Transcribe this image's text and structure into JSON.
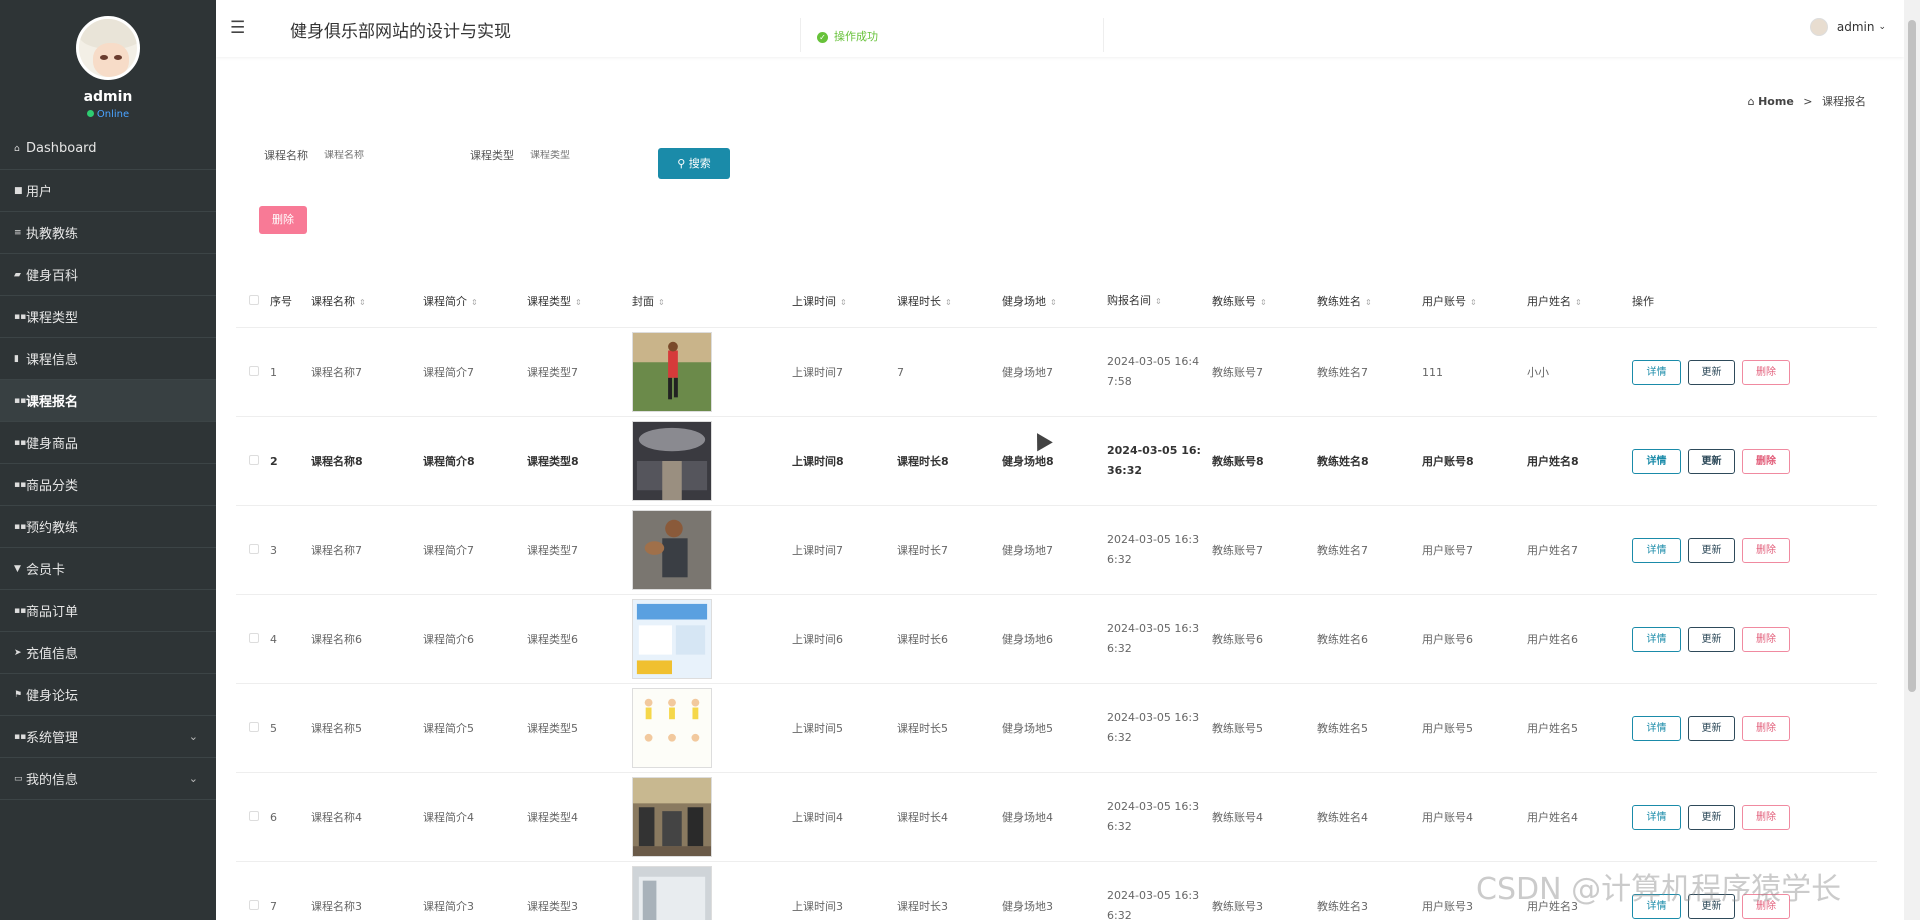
{
  "sidebar": {
    "profile": {
      "name": "admin",
      "status": "Online"
    },
    "items": [
      {
        "label": "Dashboard",
        "icon": "home-icon"
      },
      {
        "label": "用户",
        "icon": "user-icon"
      },
      {
        "label": "执教教练",
        "icon": "list-icon"
      },
      {
        "label": "健身百科",
        "icon": "book-icon"
      },
      {
        "label": "课程类型",
        "icon": "grid-icon"
      },
      {
        "label": "课程信息",
        "icon": "chart-icon"
      },
      {
        "label": "课程报名",
        "icon": "grid-icon"
      },
      {
        "label": "健身商品",
        "icon": "grid-icon"
      },
      {
        "label": "商品分类",
        "icon": "grid-icon"
      },
      {
        "label": "预约教练",
        "icon": "grid-icon"
      },
      {
        "label": "会员卡",
        "icon": "trophy-icon"
      },
      {
        "label": "商品订单",
        "icon": "grid-icon"
      },
      {
        "label": "充值信息",
        "icon": "send-icon"
      },
      {
        "label": "健身论坛",
        "icon": "flag-icon"
      },
      {
        "label": "系统管理",
        "icon": "grid-icon"
      },
      {
        "label": "我的信息",
        "icon": "card-icon"
      }
    ],
    "active_index": 6
  },
  "header": {
    "title": "健身俱乐部网站的设计与实现",
    "toast": "操作成功",
    "user": "admin"
  },
  "breadcrumb": {
    "home": "Home",
    "sep": ">",
    "current": "课程报名"
  },
  "search": {
    "course_name_label": "课程名称",
    "course_name_placeholder": "课程名称",
    "course_type_label": "课程类型",
    "course_type_placeholder": "课程类型",
    "search_button": "搜索",
    "delete_button": "删除"
  },
  "table": {
    "columns": [
      "序号",
      "课程名称",
      "课程简介",
      "课程类型",
      "封面",
      "上课时间",
      "课程时长",
      "健身场地",
      "购报名间",
      "教练账号",
      "教练姓名",
      "用户账号",
      "用户姓名",
      "操作"
    ],
    "rows": [
      {
        "idx": "1",
        "name": "课程名称7",
        "intro": "课程简介7",
        "type": "课程类型7",
        "time": "上课时间7",
        "dur": "7",
        "place": "健身场地7",
        "date": "2024-03-05 16:47:58",
        "cno": "教练账号7",
        "cname": "教练姓名7",
        "uno": "111",
        "uname": "小小",
        "bold": false,
        "cover": "runner"
      },
      {
        "idx": "2",
        "name": "课程名称8",
        "intro": "课程简介8",
        "type": "课程类型8",
        "time": "上课时间8",
        "dur": "课程时长8",
        "place": "健身场地8",
        "date": "2024-03-05 16:36:32",
        "cno": "教练账号8",
        "cname": "教练姓名8",
        "uno": "用户账号8",
        "uname": "用户姓名8",
        "bold": true,
        "cover": "gym-hall"
      },
      {
        "idx": "3",
        "name": "课程名称7",
        "intro": "课程简介7",
        "type": "课程类型7",
        "time": "上课时间7",
        "dur": "课程时长7",
        "place": "健身场地7",
        "date": "2024-03-05 16:36:32",
        "cno": "教练账号7",
        "cname": "教练姓名7",
        "uno": "用户账号7",
        "uname": "用户姓名7",
        "bold": false,
        "cover": "muscle"
      },
      {
        "idx": "4",
        "name": "课程名称6",
        "intro": "课程简介6",
        "type": "课程类型6",
        "time": "上课时间6",
        "dur": "课程时长6",
        "place": "健身场地6",
        "date": "2024-03-05 16:36:32",
        "cno": "教练账号6",
        "cname": "教练姓名6",
        "uno": "用户账号6",
        "uname": "用户姓名6",
        "bold": false,
        "cover": "poster"
      },
      {
        "idx": "5",
        "name": "课程名称5",
        "intro": "课程简介5",
        "type": "课程类型5",
        "time": "上课时间5",
        "dur": "课程时长5",
        "place": "健身场地5",
        "date": "2024-03-05 16:36:32",
        "cno": "教练账号5",
        "cname": "教练姓名5",
        "uno": "用户账号5",
        "uname": "用户姓名5",
        "bold": false,
        "cover": "cartoon"
      },
      {
        "idx": "6",
        "name": "课程名称4",
        "intro": "课程简介4",
        "type": "课程类型4",
        "time": "上课时间4",
        "dur": "课程时长4",
        "place": "健身场地4",
        "date": "2024-03-05 16:36:32",
        "cno": "教练账号4",
        "cname": "教练姓名4",
        "uno": "用户账号4",
        "uname": "用户姓名4",
        "bold": false,
        "cover": "machines"
      },
      {
        "idx": "7",
        "name": "课程名称3",
        "intro": "课程简介3",
        "type": "课程类型3",
        "time": "上课时间3",
        "dur": "课程时长3",
        "place": "健身场地3",
        "date": "2024-03-05 16:36:32",
        "cno": "教练账号3",
        "cname": "教练姓名3",
        "uno": "用户账号3",
        "uname": "用户姓名3",
        "bold": false,
        "cover": "room"
      }
    ],
    "ops": {
      "detail": "详情",
      "update": "更新",
      "delete": "删除"
    }
  },
  "watermark": "CSDN @计算机程序猿学长",
  "colors": {
    "sidebar_bg": "#2e3436",
    "primary": "#1a8ba9",
    "danger": "#f87a96",
    "success": "#67c23a"
  }
}
